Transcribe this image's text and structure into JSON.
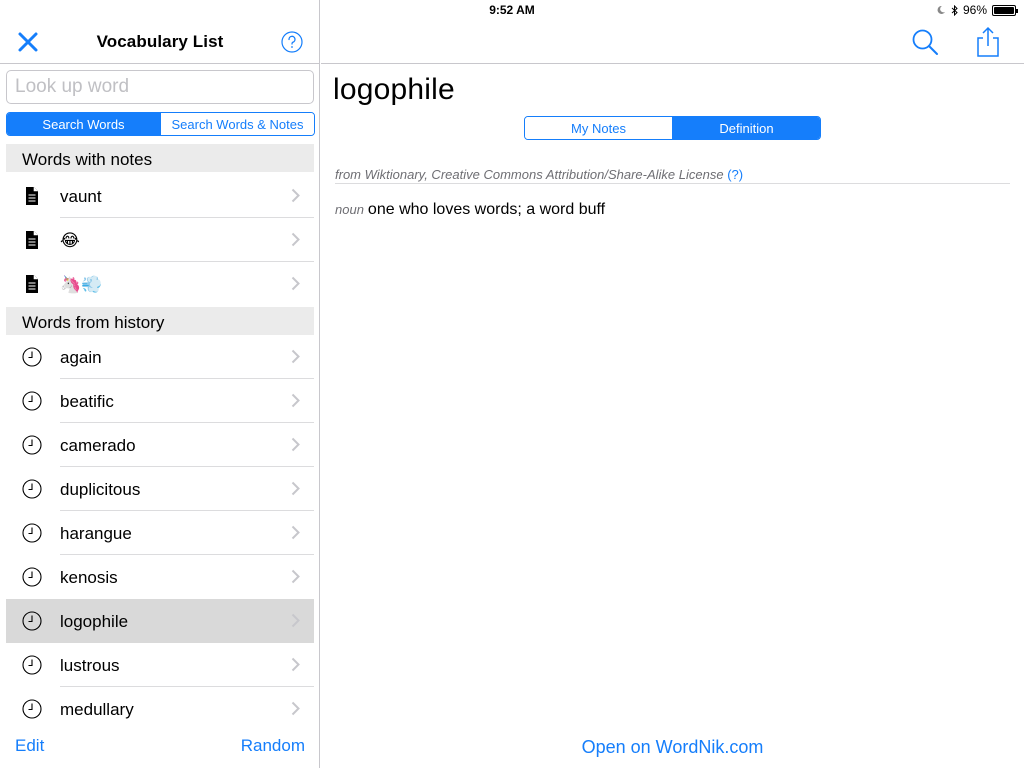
{
  "status_bar": {
    "device": "iPad",
    "time": "9:52 AM",
    "battery": "96%"
  },
  "left_nav": {
    "title": "Vocabulary List",
    "close_icon": "close-x-icon",
    "help_icon": "question-circle-icon"
  },
  "search": {
    "placeholder": "Look up word",
    "value": ""
  },
  "search_scope": {
    "options": [
      "Search Words",
      "Search Words & Notes"
    ],
    "selected": "Search Words"
  },
  "sections": {
    "notes_header": "Words with notes",
    "history_header": "Words from history"
  },
  "notes_words": [
    {
      "label": "vaunt",
      "icon": "document-icon"
    },
    {
      "label": "😂",
      "icon": "document-icon"
    },
    {
      "label": "🦄💨",
      "icon": "document-icon"
    }
  ],
  "history_words": [
    {
      "label": "again",
      "icon": "clock-icon"
    },
    {
      "label": "beatific",
      "icon": "clock-icon"
    },
    {
      "label": "camerado",
      "icon": "clock-icon"
    },
    {
      "label": "duplicitous",
      "icon": "clock-icon"
    },
    {
      "label": "harangue",
      "icon": "clock-icon"
    },
    {
      "label": "kenosis",
      "icon": "clock-icon"
    },
    {
      "label": "logophile",
      "icon": "clock-icon",
      "selected": true
    },
    {
      "label": "lustrous",
      "icon": "clock-icon"
    },
    {
      "label": "medullary",
      "icon": "clock-icon"
    }
  ],
  "left_toolbar": {
    "edit": "Edit",
    "random": "Random"
  },
  "right_nav": {
    "search_icon": "magnifier-icon",
    "share_icon": "share-icon"
  },
  "detail": {
    "word": "logophile",
    "tabs": [
      "My Notes",
      "Definition"
    ],
    "selected_tab": "Definition",
    "source": "from Wiktionary, Creative Commons Attribution/Share-Alike License",
    "source_help": "(?)",
    "part_of_speech": "noun",
    "definition": "one who loves words; a word buff",
    "open_link": "Open on WordNik.com"
  },
  "colors": {
    "accent": "#157efb",
    "section_bg": "#ebebeb",
    "selected_row": "#d9d9d9",
    "separator": "#c8c7cc"
  }
}
